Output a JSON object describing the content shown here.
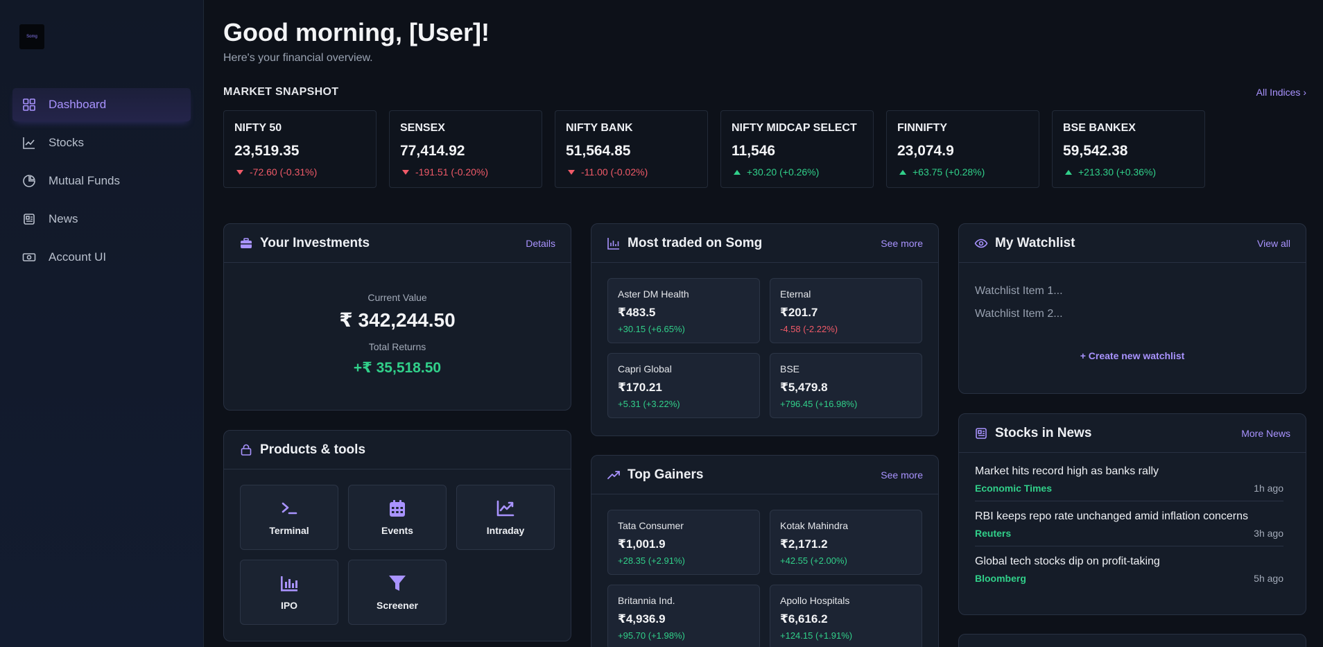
{
  "brand": {
    "logo_text": "Somg"
  },
  "sidebar": {
    "items": [
      {
        "label": "Dashboard",
        "icon": "grid-icon",
        "active": true
      },
      {
        "label": "Stocks",
        "icon": "chart-line-icon"
      },
      {
        "label": "Mutual Funds",
        "icon": "pie-chart-icon"
      },
      {
        "label": "News",
        "icon": "newspaper-icon"
      },
      {
        "label": "Account UI",
        "icon": "cash-icon"
      }
    ]
  },
  "header": {
    "greeting": "Good morning, [User]!",
    "subtitle": "Here's your financial overview."
  },
  "market": {
    "title": "MARKET SNAPSHOT",
    "link": "All Indices",
    "indices": [
      {
        "name": "NIFTY 50",
        "value": "23,519.35",
        "change": "-72.60 (-0.31%)",
        "direction": "down"
      },
      {
        "name": "SENSEX",
        "value": "77,414.92",
        "change": "-191.51 (-0.20%)",
        "direction": "down"
      },
      {
        "name": "NIFTY BANK",
        "value": "51,564.85",
        "change": "-11.00 (-0.02%)",
        "direction": "down"
      },
      {
        "name": "NIFTY MIDCAP SELECT",
        "value": "11,546",
        "change": "+30.20 (+0.26%)",
        "direction": "up"
      },
      {
        "name": "FINNIFTY",
        "value": "23,074.9",
        "change": "+63.75 (+0.28%)",
        "direction": "up"
      },
      {
        "name": "BSE BANKEX",
        "value": "59,542.38",
        "change": "+213.30 (+0.36%)",
        "direction": "up"
      }
    ]
  },
  "investments": {
    "title": "Your Investments",
    "link": "Details",
    "current_label": "Current Value",
    "current_value": "₹ 342,244.50",
    "returns_label": "Total Returns",
    "returns_value": "+₹ 35,518.50"
  },
  "tools": {
    "title": "Products & tools",
    "items": [
      {
        "label": "Terminal",
        "icon": "terminal-icon"
      },
      {
        "label": "Events",
        "icon": "calendar-icon"
      },
      {
        "label": "Intraday",
        "icon": "chart-up-icon"
      },
      {
        "label": "IPO",
        "icon": "bar-chart-icon"
      },
      {
        "label": "Screener",
        "icon": "filter-icon"
      }
    ]
  },
  "most_traded": {
    "title": "Most traded on Somg",
    "link": "See more",
    "items": [
      {
        "name": "Aster DM Health",
        "price": "₹483.5",
        "change": "+30.15 (+6.65%)",
        "direction": "up"
      },
      {
        "name": "Eternal",
        "price": "₹201.7",
        "change": "-4.58 (-2.22%)",
        "direction": "down"
      },
      {
        "name": "Capri Global",
        "price": "₹170.21",
        "change": "+5.31 (+3.22%)",
        "direction": "up"
      },
      {
        "name": "BSE",
        "price": "₹5,479.8",
        "change": "+796.45 (+16.98%)",
        "direction": "up"
      }
    ]
  },
  "top_gainers": {
    "title": "Top Gainers",
    "link": "See more",
    "items": [
      {
        "name": "Tata Consumer",
        "price": "₹1,001.9",
        "change": "+28.35 (+2.91%)",
        "direction": "up"
      },
      {
        "name": "Kotak Mahindra",
        "price": "₹2,171.2",
        "change": "+42.55 (+2.00%)",
        "direction": "up"
      },
      {
        "name": "Britannia Ind.",
        "price": "₹4,936.9",
        "change": "+95.70 (+1.98%)",
        "direction": "up"
      },
      {
        "name": "Apollo Hospitals",
        "price": "₹6,616.2",
        "change": "+124.15 (+1.91%)",
        "direction": "up"
      }
    ]
  },
  "watchlist": {
    "title": "My Watchlist",
    "link": "View all",
    "items": [
      "Watchlist Item 1...",
      "Watchlist Item 2..."
    ],
    "create": "+ Create new watchlist"
  },
  "news": {
    "title": "Stocks in News",
    "link": "More News",
    "items": [
      {
        "headline": "Market hits record high as banks rally",
        "source": "Economic Times",
        "time": "1h ago"
      },
      {
        "headline": "RBI keeps repo rate unchanged amid inflation concerns",
        "source": "Reuters",
        "time": "3h ago"
      },
      {
        "headline": "Global tech stocks dip on profit-taking",
        "source": "Bloomberg",
        "time": "5h ago"
      }
    ]
  },
  "colors": {
    "accent": "#a993ff",
    "positive": "#31d08a",
    "negative": "#f05a68",
    "background": "#0d1119"
  }
}
